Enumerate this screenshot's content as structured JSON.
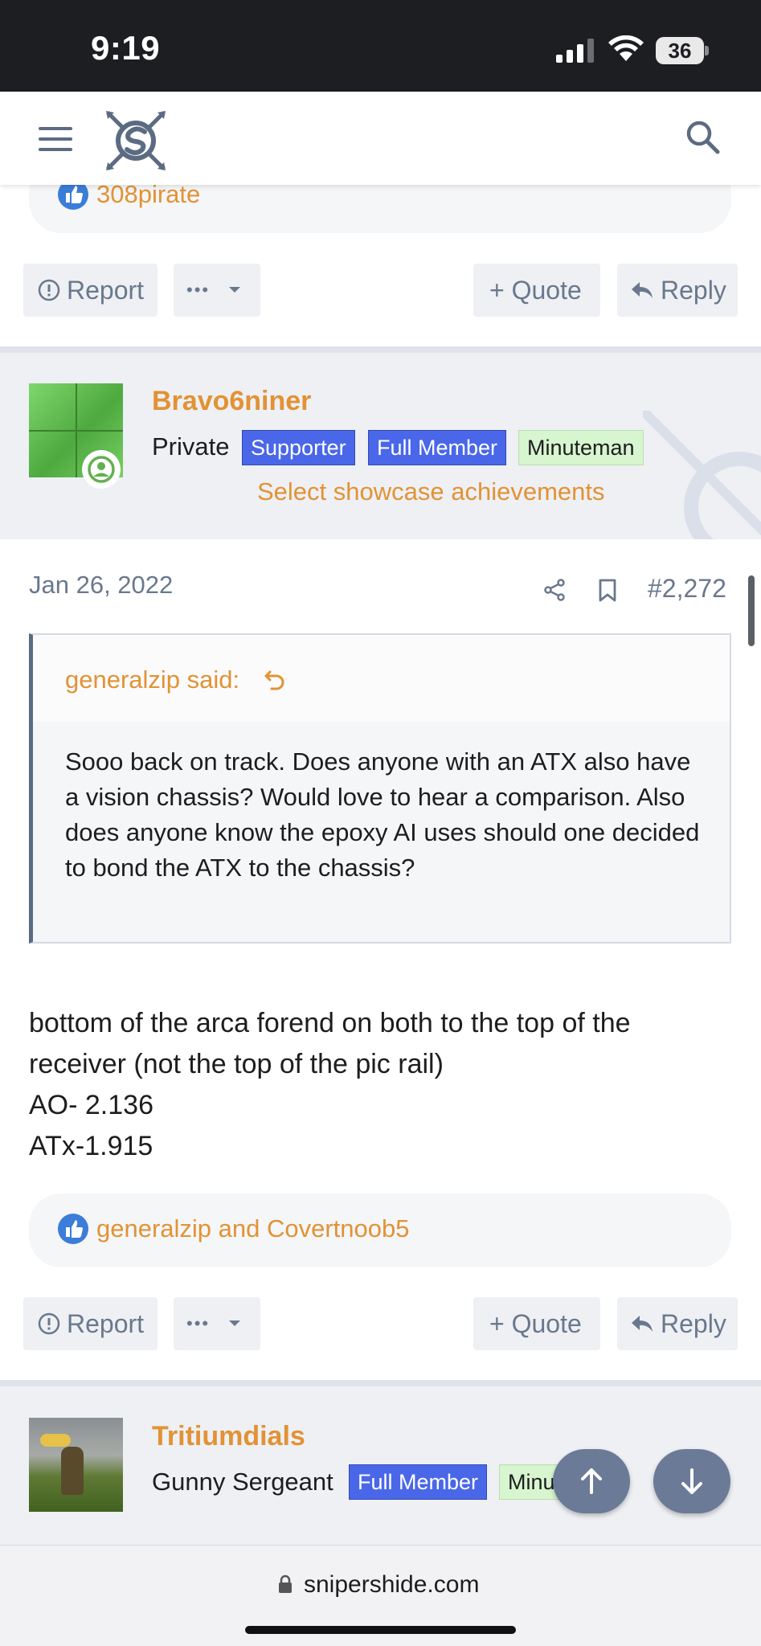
{
  "status_bar": {
    "time": "9:19",
    "battery": "36"
  },
  "header": {
    "logo_alt": "Sniper's Hide logo"
  },
  "prev_post": {
    "reactions": "308pirate",
    "report_label": "Report",
    "more_label": "•••",
    "quote_label": "+ Quote",
    "reply_label": "Reply"
  },
  "post": {
    "author": "Bravo6niner",
    "rank": "Private",
    "badges": [
      "Supporter",
      "Full Member",
      "Minuteman"
    ],
    "showcase_link": "Select showcase achievements",
    "date": "Jan 26, 2022",
    "post_number": "#2,272",
    "quote": {
      "author_line": "generalzip said:",
      "text": "Sooo back on track. Does anyone with an ATX also have a vision chassis? Would love to hear a comparison. Also does anyone know the epoxy AI uses should one decided to bond the ATX to the chassis?"
    },
    "body": [
      "bottom of the arca forend on both to the top of the receiver (not the top of the pic rail)",
      "AO- 2.136",
      "ATx-1.915"
    ],
    "reactions": "generalzip and Covertnoob5",
    "report_label": "Report",
    "more_label": "•••",
    "quote_label": "+ Quote",
    "reply_label": "Reply"
  },
  "next_post": {
    "author": "Tritiumdials",
    "rank": "Gunny Sergeant",
    "badges": [
      "Full Member",
      "Minuteman"
    ]
  },
  "browser": {
    "url": "snipershide.com"
  },
  "colors": {
    "accent": "#e29234",
    "badge_blue": "#4967e8",
    "badge_green": "#d7f5cf",
    "link_blue": "#3b7dd8"
  }
}
